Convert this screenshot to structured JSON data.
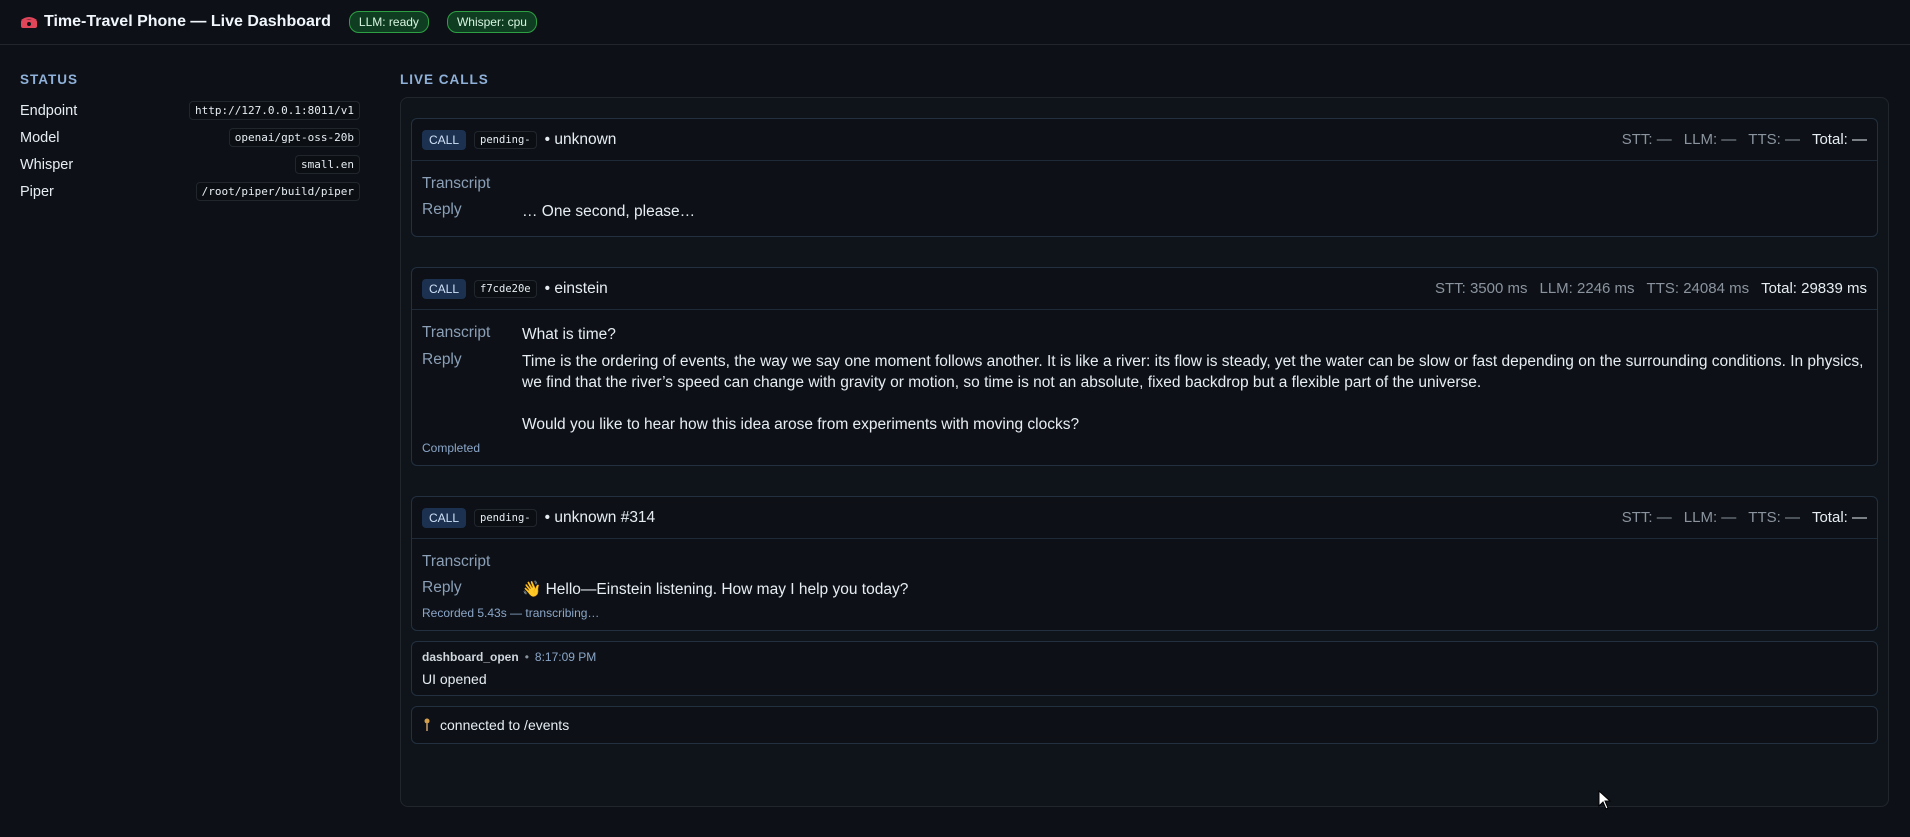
{
  "header": {
    "title": "Time-Travel Phone — Live Dashboard",
    "icon": "telephone-icon",
    "badges": [
      {
        "label": "LLM: ready"
      },
      {
        "label": "Whisper: cpu"
      }
    ]
  },
  "status": {
    "title": "STATUS",
    "rows": [
      {
        "label": "Endpoint",
        "value": "http://127.0.0.1:8011/v1"
      },
      {
        "label": "Model",
        "value": "openai/gpt-oss-20b"
      },
      {
        "label": "Whisper",
        "value": "small.en"
      },
      {
        "label": "Piper",
        "value": "/root/piper/build/piper"
      }
    ]
  },
  "live": {
    "title": "LIVE CALLS",
    "calls": [
      {
        "tag": "CALL",
        "id": "pending-",
        "caller": "• unknown",
        "stt": "STT: —",
        "llm": "LLM: —",
        "tts": "TTS: —",
        "total": "Total: —",
        "transcript_label": "Transcript",
        "transcript": "",
        "reply_label": "Reply",
        "reply": "… One second, please…",
        "note": ""
      },
      {
        "tag": "CALL",
        "id": "f7cde20e",
        "caller": "• einstein",
        "stt": "STT: 3500 ms",
        "llm": "LLM: 2246 ms",
        "tts": "TTS: 24084 ms",
        "total": "Total: 29839 ms",
        "transcript_label": "Transcript",
        "transcript": "What is time?",
        "reply_label": "Reply",
        "reply_p1": "Time is the ordering of events, the way we say one moment follows another. It is like a river: its flow is steady, yet the water can be slow or fast depending on the surrounding conditions. In physics, we find that the river’s speed can change with gravity or motion, so time is not an absolute, fixed backdrop but a flexible part of the universe.",
        "reply_p2": "Would you like to hear how this idea arose from experiments with moving clocks?",
        "note": "Completed"
      },
      {
        "tag": "CALL",
        "id": "pending-",
        "caller": "• unknown #314",
        "stt": "STT: —",
        "llm": "LLM: —",
        "tts": "TTS: —",
        "total": "Total: —",
        "transcript_label": "Transcript",
        "transcript": "",
        "reply_label": "Reply",
        "reply": "👋 Hello—Einstein listening. How may I help you today?",
        "note": "Recorded 5.43s — transcribing…"
      }
    ],
    "event": {
      "type": "dashboard_open",
      "sep": "•",
      "time": "8:17:09 PM",
      "message": "UI opened"
    },
    "connection": {
      "icon": "connection-indicator-icon",
      "text": "connected to /events"
    }
  },
  "colors": {
    "background": "#0d1117",
    "badge_bg": "#0f3d22",
    "badge_border": "#2ea043",
    "accent": "#8fb0d8"
  }
}
